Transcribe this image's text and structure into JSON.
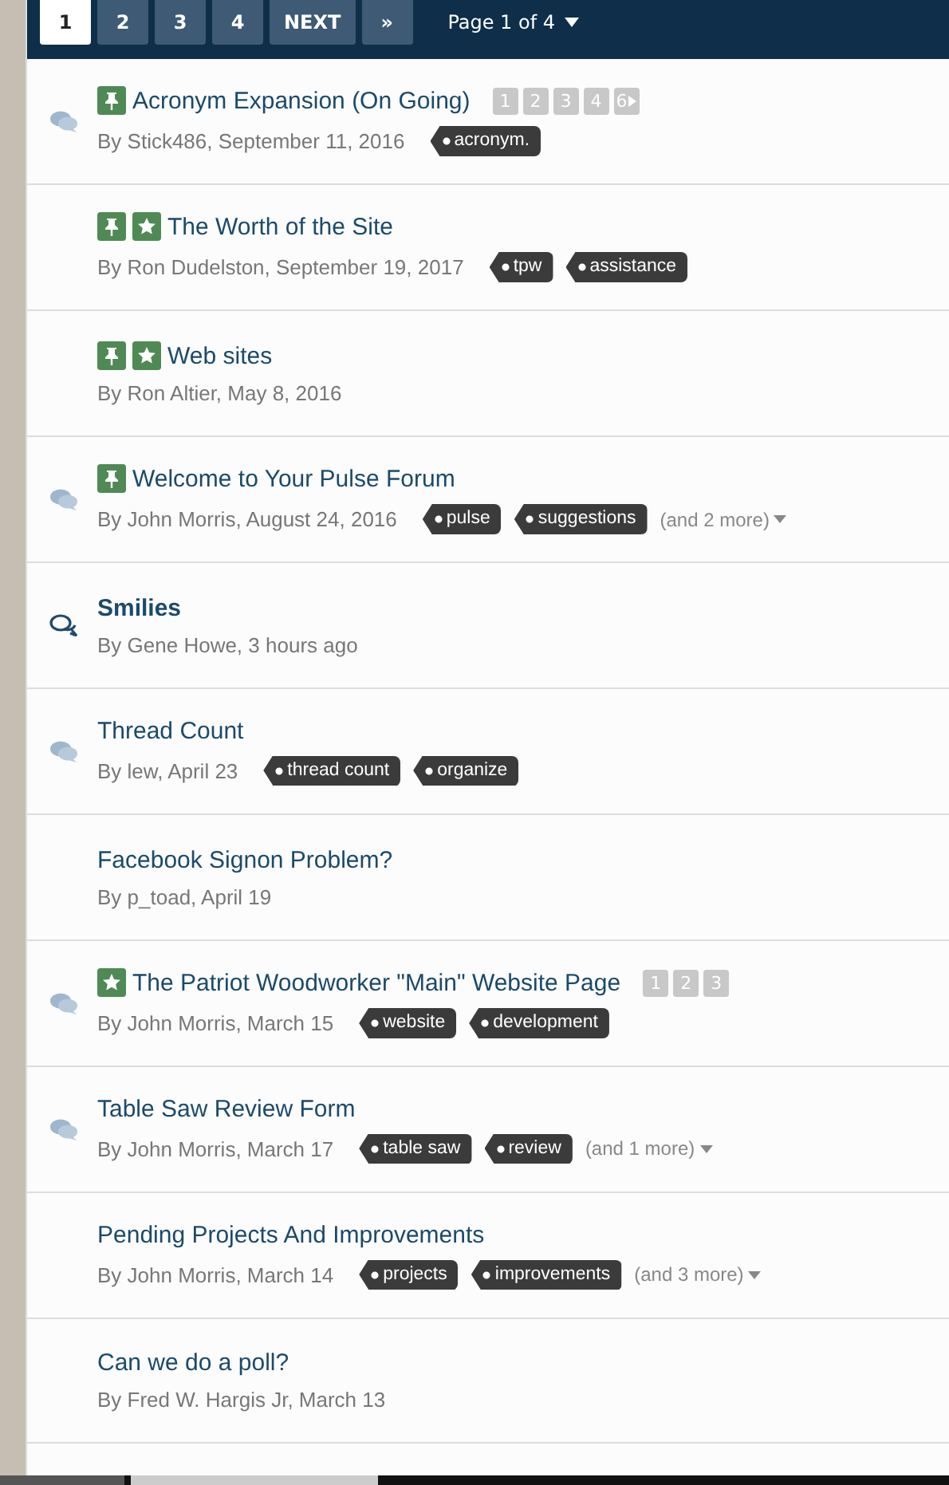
{
  "pagination": {
    "pages": [
      {
        "label": "1",
        "selected": true
      },
      {
        "label": "2",
        "selected": false
      },
      {
        "label": "3",
        "selected": false
      },
      {
        "label": "4",
        "selected": false
      }
    ],
    "next": "NEXT",
    "last": "»",
    "page_jump": "Page 1 of 4"
  },
  "topics": [
    {
      "replied": true,
      "pinned": true,
      "featured": false,
      "title": "Acronym Expansion (On Going)",
      "unread": false,
      "mini_pages": [
        "1",
        "2",
        "3",
        "4",
        "6"
      ],
      "mini_next": true,
      "meta": "By Stick486, September 11, 2016",
      "tags": [
        "acronym."
      ]
    },
    {
      "replied": false,
      "pinned": true,
      "featured": true,
      "title": "The Worth of the Site",
      "unread": false,
      "meta": "By Ron Dudelston, September 19, 2017",
      "tags": [
        "tpw",
        "assistance"
      ]
    },
    {
      "replied": false,
      "pinned": true,
      "featured": true,
      "title": "Web sites",
      "unread": false,
      "meta": "By Ron Altier, May 8, 2016"
    },
    {
      "replied": true,
      "pinned": true,
      "featured": false,
      "title": "Welcome to Your Pulse Forum",
      "unread": false,
      "meta": "By John Morris, August 24, 2016",
      "tags": [
        "pulse",
        "suggestions"
      ],
      "more": "(and 2 more)"
    },
    {
      "replied": true,
      "pinned": false,
      "featured": false,
      "title": "Smilies",
      "unread": true,
      "meta": "By Gene Howe, 3 hours ago"
    },
    {
      "replied": true,
      "pinned": false,
      "featured": false,
      "title": "Thread Count",
      "unread": false,
      "meta": "By lew, April 23",
      "tags": [
        "thread count",
        "organize"
      ]
    },
    {
      "replied": false,
      "pinned": false,
      "featured": false,
      "title": "Facebook Signon Problem?",
      "unread": false,
      "meta": "By p_toad, April 19"
    },
    {
      "replied": true,
      "pinned": false,
      "featured": true,
      "title": "The Patriot Woodworker \"Main\" Website Page",
      "unread": false,
      "mini_pages": [
        "1",
        "2",
        "3"
      ],
      "meta": "By John Morris, March 15",
      "tags": [
        "website",
        "development"
      ]
    },
    {
      "replied": true,
      "pinned": false,
      "featured": false,
      "title": "Table Saw Review Form",
      "unread": false,
      "meta": "By John Morris, March 17",
      "tags": [
        "table saw",
        "review"
      ],
      "more": "(and 1 more)"
    },
    {
      "replied": false,
      "pinned": false,
      "featured": false,
      "title": "Pending Projects And Improvements",
      "unread": false,
      "meta": "By John Morris, March 14",
      "tags": [
        "projects",
        "improvements"
      ],
      "more": "(and 3 more)"
    },
    {
      "replied": false,
      "pinned": false,
      "featured": false,
      "title": "Can we do a poll?",
      "unread": false,
      "meta": "By Fred W. Hargis Jr, March 13"
    }
  ]
}
